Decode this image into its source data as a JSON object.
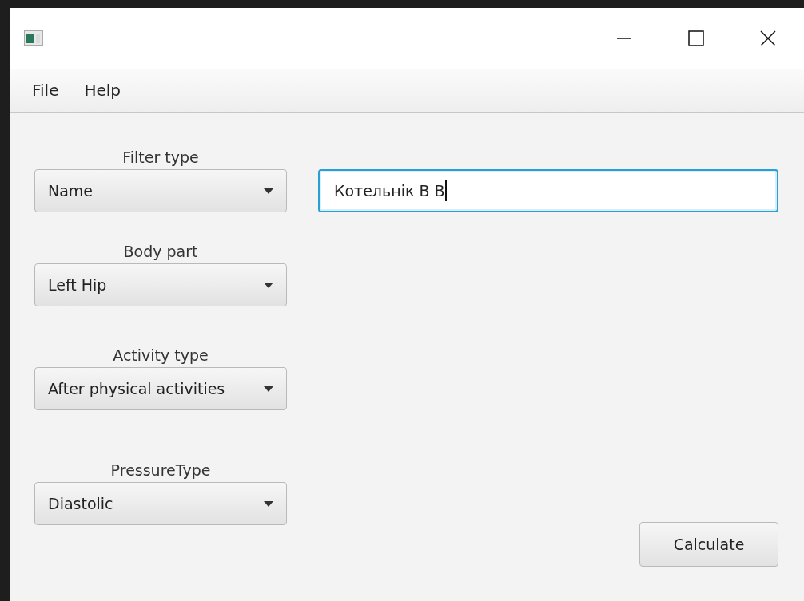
{
  "menu": [
    "File",
    "Help"
  ],
  "dropdowns": [
    {
      "label": "Filter type",
      "value": "Name"
    },
    {
      "label": "Body part",
      "value": "Left Hip"
    },
    {
      "label": "Activity type",
      "value": "After physical activities"
    },
    {
      "label": "PressureType",
      "value": "Diastolic"
    }
  ],
  "search_field": {
    "value": "Котельнік В В",
    "focused": true
  },
  "calculate_button": "Calculate"
}
